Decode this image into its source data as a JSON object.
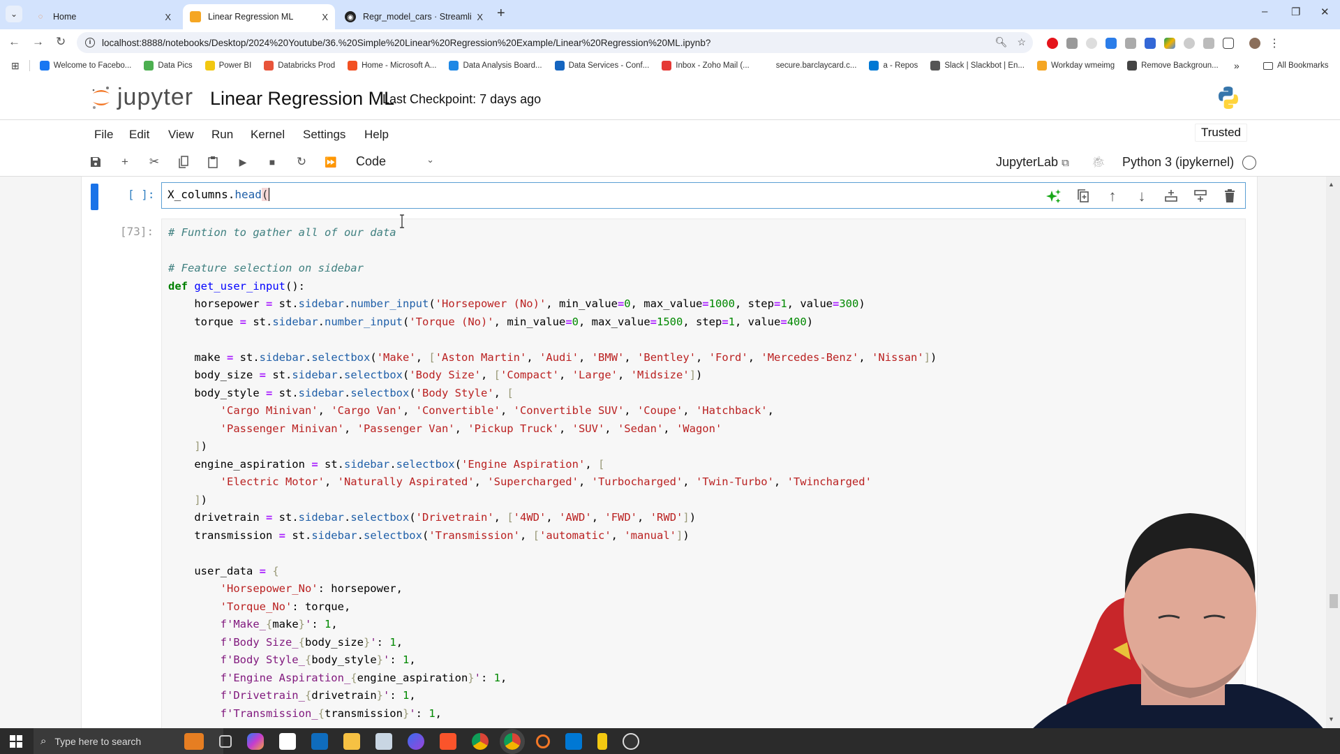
{
  "browser": {
    "tabs": [
      {
        "label": "Home",
        "active": false,
        "icon": "jupyter-icon"
      },
      {
        "label": "Linear Regression ML",
        "active": true,
        "icon": "notebook-icon"
      },
      {
        "label": "Regr_model_cars · Streamlit",
        "active": false,
        "icon": "streamlit-icon"
      }
    ],
    "close_glyph": "X",
    "new_tab_glyph": "+",
    "url": "localhost:8888/notebooks/Desktop/2024%20Youtube/36.%20Simple%20Linear%20Regression%20Example/Linear%20Regression%20ML.ipynb?",
    "bookmarks": [
      {
        "label": "Welcome to Facebo...",
        "color": "#1877f2"
      },
      {
        "label": "Data Pics",
        "color": "#4caf50"
      },
      {
        "label": "Power BI",
        "color": "#f2c811"
      },
      {
        "label": "Databricks Prod",
        "color": "#e8543a"
      },
      {
        "label": "Home - Microsoft A...",
        "color": "#f25022"
      },
      {
        "label": "Data Analysis Board...",
        "color": "#1e88e5"
      },
      {
        "label": "Data Services - Conf...",
        "color": "#1565c0"
      },
      {
        "label": "Inbox - Zoho Mail (...",
        "color": "#e53935"
      },
      {
        "label": "secure.barclaycard.c...",
        "color": "#ffffff"
      },
      {
        "label": "a - Repos",
        "color": "#0078d4"
      },
      {
        "label": "Slack | Slackbot | En...",
        "color": "#555555"
      },
      {
        "label": "Workday wmeimg",
        "color": "#f5a623"
      },
      {
        "label": "Remove Backgroun...",
        "color": "#444444"
      }
    ],
    "more_bookmarks": "»",
    "all_bookmarks": "All Bookmarks"
  },
  "jupyter": {
    "wordmark": "jupyter",
    "notebook_title": "Linear Regression ML",
    "checkpoint": "Last Checkpoint: 7 days ago",
    "menu": [
      "File",
      "Edit",
      "View",
      "Run",
      "Kernel",
      "Settings",
      "Help"
    ],
    "trusted": "Trusted",
    "cell_type": "Code",
    "jupyterlab_link": "JupyterLab",
    "kernel": "Python 3 (ipykernel)"
  },
  "cells": {
    "active": {
      "prompt": "[ ]:",
      "code_prefix": "X_columns.",
      "code_method": "head",
      "code_paren": "("
    },
    "executed": {
      "prompt": "[73]:"
    }
  },
  "taskbar": {
    "search_placeholder": "Type here to search"
  }
}
